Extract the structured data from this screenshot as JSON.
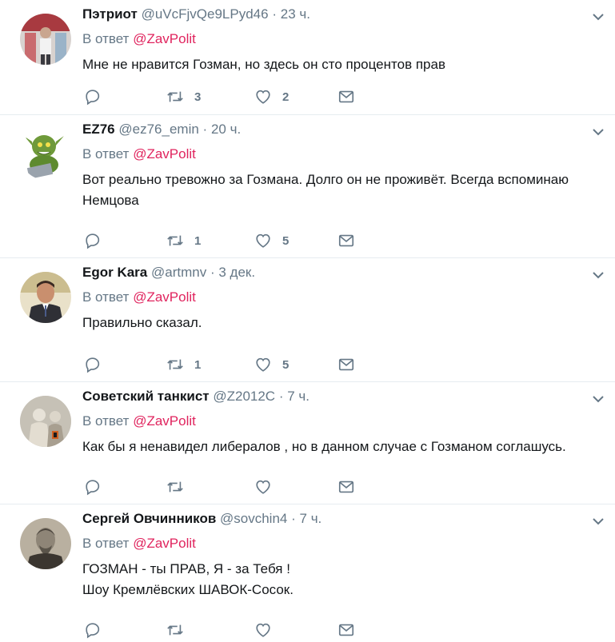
{
  "reply_label": "В ответ",
  "tweets": [
    {
      "name": "Пэтриот",
      "handle": "@uVcFjvQe9LPyd46",
      "time": "23 ч.",
      "reply_to": "@ZavPolit",
      "lines": [
        "Мне не нравится Гозман, но здесь он сто процентов прав"
      ],
      "retweets": "3",
      "likes": "2"
    },
    {
      "name": "EZ76",
      "handle": "@ez76_emin",
      "time": "20 ч.",
      "reply_to": "@ZavPolit",
      "lines": [
        "Вот реально тревожно за Гозмана. Долго он не проживёт. Всегда вспоминаю",
        "Немцова"
      ],
      "retweets": "1",
      "likes": "5"
    },
    {
      "name": "Egor Kara",
      "handle": "@artmnv",
      "time": "3 дек.",
      "reply_to": "@ZavPolit",
      "lines": [
        "Правильно сказал."
      ],
      "retweets": "1",
      "likes": "5"
    },
    {
      "name": "Советский танкист",
      "handle": "@Z2012C",
      "time": "7 ч.",
      "reply_to": "@ZavPolit",
      "lines": [
        "Как бы я ненавидел либералов , но в данном случае с Гозманом соглашусь."
      ],
      "retweets": "",
      "likes": ""
    },
    {
      "name": "Сергей Овчинников",
      "handle": "@sovchin4",
      "time": "7 ч.",
      "reply_to": "@ZavPolit",
      "lines": [
        "ГОЗМАН - ты ПРАВ, Я - за Тебя !",
        "Шоу Кремлёвских ШАВОК-Сосок."
      ],
      "retweets": "",
      "likes": ""
    }
  ],
  "colors": {
    "accent": "#e0245e",
    "muted": "#657786",
    "border": "#e6ecf0"
  }
}
